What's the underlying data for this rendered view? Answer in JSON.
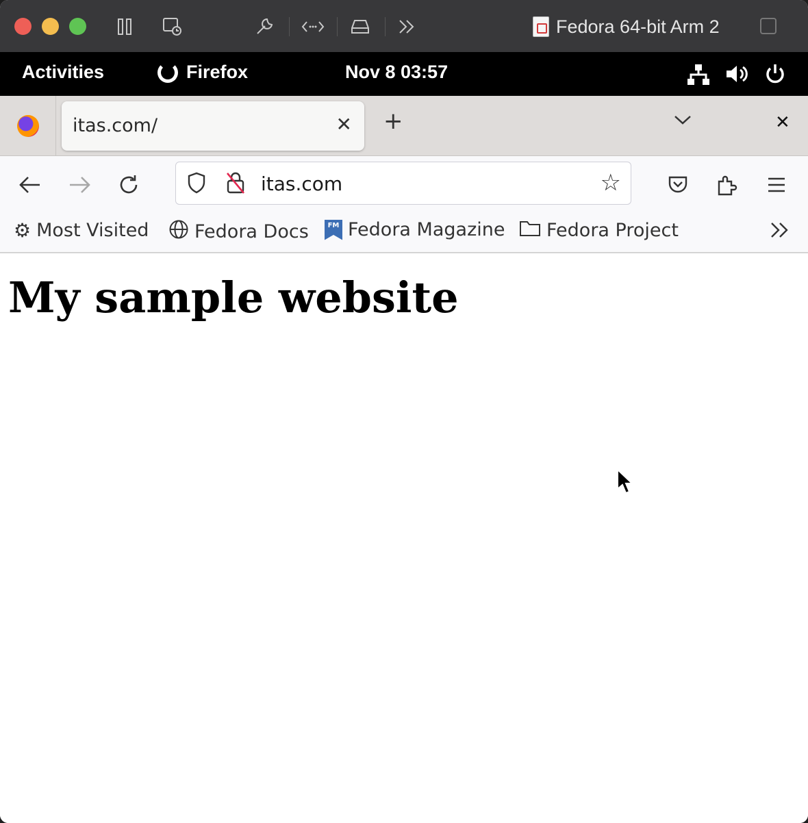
{
  "vm": {
    "title": "Fedora 64-bit Arm 2"
  },
  "gnome": {
    "activities": "Activities",
    "app_name": "Firefox",
    "clock": "Nov 8  03:57"
  },
  "browser": {
    "tab_title": "itas.com/",
    "url": "itas.com",
    "bookmarks": [
      {
        "label": "Most Visited",
        "icon": "gear-icon"
      },
      {
        "label": "Fedora Docs",
        "icon": "globe-icon"
      },
      {
        "label": "Fedora Magazine",
        "icon": "fedora-magazine-icon",
        "icon_text": "FM"
      },
      {
        "label": "Fedora Project",
        "icon": "folder-icon"
      }
    ]
  },
  "page": {
    "heading": "My sample website"
  },
  "colors": {
    "mac_close": "#ee5f57",
    "mac_minimize": "#f4bd4f",
    "mac_maximize": "#5fc454"
  }
}
